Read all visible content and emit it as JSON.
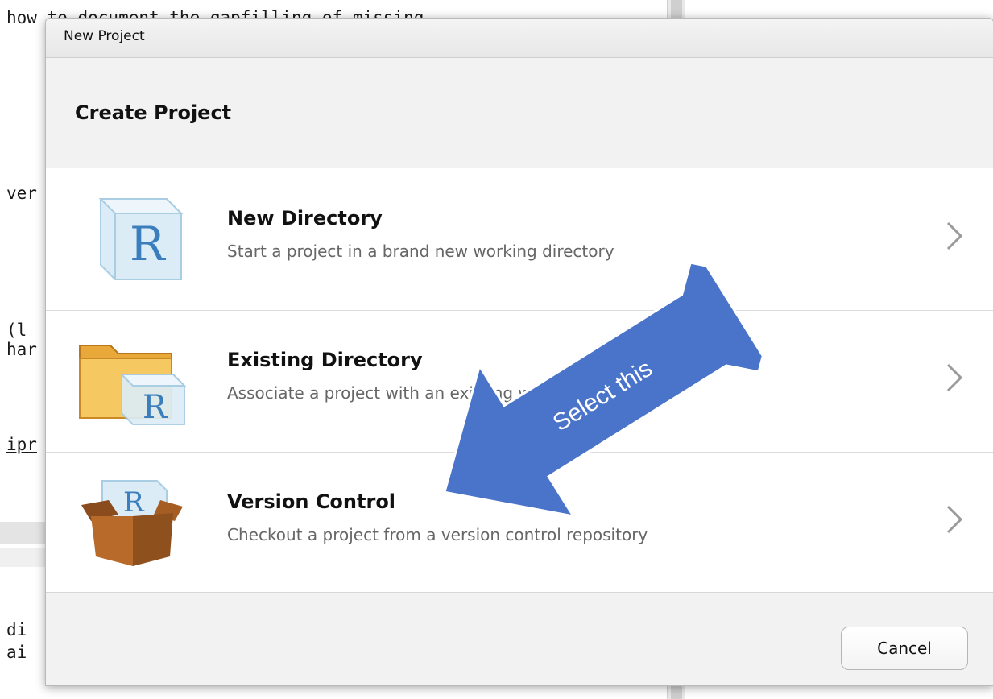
{
  "background_editor": {
    "lines": [
      "how to document the gapfilling of missing",
      "ver",
      "(l",
      "har",
      "ipr",
      "di",
      "ai"
    ]
  },
  "dialog": {
    "window_title": "New Project",
    "heading": "Create Project",
    "options": [
      {
        "title": "New Directory",
        "description": "Start a project in a brand new working directory",
        "icon": "r-cube-icon"
      },
      {
        "title": "Existing Directory",
        "description": "Associate a project with an existing working directory",
        "icon": "folder-r-icon"
      },
      {
        "title": "Version Control",
        "description": "Checkout a project from a version control repository",
        "icon": "box-r-icon"
      }
    ],
    "cancel_label": "Cancel"
  },
  "annotation": {
    "arrow_label": "Select this",
    "arrow_color": "#4a74c9"
  }
}
